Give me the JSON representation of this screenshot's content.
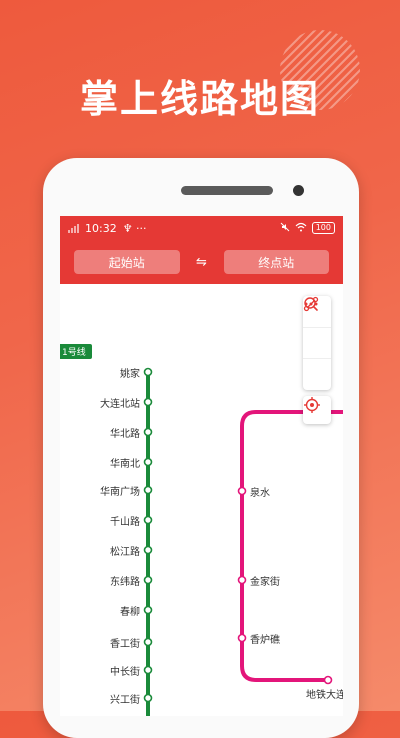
{
  "headline": "掌上线路地图",
  "status": {
    "time": "10:32",
    "extra": "♆ ···",
    "battery": "100"
  },
  "toolbar": {
    "start_label": "起始站",
    "swap_glyph": "⇋",
    "end_label": "终点站"
  },
  "line1": {
    "badge": "1号线",
    "color": "#1a8a3a",
    "stations": [
      "姚家",
      "大连北站",
      "华北路",
      "华南北",
      "华南广场",
      "千山路",
      "松江路",
      "东纬路",
      "春柳",
      "香工街",
      "中长街",
      "兴工街"
    ]
  },
  "line2": {
    "color": "#e3157a",
    "stations": [
      "泉水",
      "金家街",
      "香炉礁",
      "地铁大连"
    ]
  },
  "tools": {
    "route": "route-icon",
    "search": "search-icon",
    "more": "more-icon",
    "locate": "locate-icon"
  },
  "colors": {
    "accent": "#e53935"
  }
}
